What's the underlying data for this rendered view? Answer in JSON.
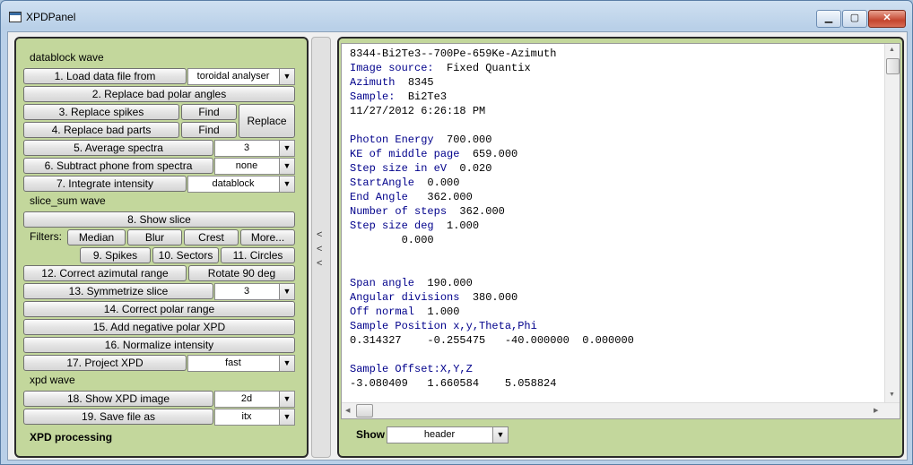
{
  "window": {
    "title": "XPDPanel",
    "min_symbol": "▁",
    "max_symbol": "▢",
    "close_symbol": "✕"
  },
  "left": {
    "section_datablock": "datablock wave",
    "load": {
      "label": "1. Load data file from",
      "value": "toroidal analyser"
    },
    "replace_polar": "2. Replace bad polar angles",
    "replace_spikes": "3. Replace spikes",
    "find1": "Find",
    "replace_parts": "4. Replace bad parts",
    "find2": "Find",
    "replace": "Replace",
    "average": {
      "label": "5. Average spectra",
      "value": "3"
    },
    "subtract": {
      "label": "6. Subtract phone from spectra",
      "value": "none"
    },
    "integrate": {
      "label": "7. Integrate intensity",
      "value": "datablock"
    },
    "section_slice": "slice_sum wave",
    "show_slice": "8. Show slice",
    "filters_label": "Filters:",
    "median": "Median",
    "blur": "Blur",
    "crest": "Crest",
    "more": "More...",
    "spikes": "9. Spikes",
    "sectors": "10. Sectors",
    "circles": "11. Circles",
    "correct_az": "12. Correct azimutal range",
    "rotate": "Rotate 90 deg",
    "symmetrize": {
      "label": "13. Symmetrize slice",
      "value": "3"
    },
    "correct_polar": "14. Correct polar range",
    "add_negative": "15. Add negative polar XPD",
    "normalize": "16. Normalize intensity",
    "project": {
      "label": "17. Project XPD",
      "value": "fast"
    },
    "section_xpd": "xpd wave",
    "show_xpd": {
      "label": "18. Show XPD image",
      "value": "2d"
    },
    "save": {
      "label": "19. Save file as",
      "value": "itx"
    },
    "footer": "XPD processing"
  },
  "splitter": {
    "arrows": [
      "<",
      "<",
      "<"
    ]
  },
  "right": {
    "lines": [
      {
        "k": "",
        "v": "8344-Bi2Te3--700Pe-659Ke-Azimuth"
      },
      {
        "k": "Image source:",
        "v": "  Fixed Quantix"
      },
      {
        "k": "Azimuth",
        "v": "  8345"
      },
      {
        "k": "Sample:",
        "v": "  Bi2Te3"
      },
      {
        "k": "",
        "v": "11/27/2012 6:26:18 PM"
      },
      {
        "k": "",
        "v": ""
      },
      {
        "k": "Photon Energy",
        "v": "  700.000"
      },
      {
        "k": "KE of middle page",
        "v": "  659.000"
      },
      {
        "k": "Step size in eV",
        "v": "  0.020"
      },
      {
        "k": "StartAngle",
        "v": "  0.000"
      },
      {
        "k": "End Angle",
        "v": "   362.000"
      },
      {
        "k": "Number of steps",
        "v": "  362.000"
      },
      {
        "k": "Step size deg",
        "v": "  1.000"
      },
      {
        "k": "",
        "v": "        0.000"
      },
      {
        "k": "",
        "v": ""
      },
      {
        "k": "",
        "v": ""
      },
      {
        "k": "Span angle",
        "v": "  190.000"
      },
      {
        "k": "Angular divisions",
        "v": "  380.000"
      },
      {
        "k": "Off normal",
        "v": "  1.000"
      },
      {
        "k": "Sample Position x,y,Theta,Phi",
        "v": ""
      },
      {
        "k": "",
        "v": "0.314327    -0.255475   -40.000000  0.000000"
      },
      {
        "k": "",
        "v": ""
      },
      {
        "k": "Sample Offset:X,Y,Z",
        "v": ""
      },
      {
        "k": "",
        "v": "-3.080409   1.660584    5.058824"
      }
    ],
    "show_label": "Show",
    "show_value": "header",
    "scroll_up": "▲",
    "scroll_down": "▼",
    "scroll_left": "◀",
    "scroll_right": "▶"
  }
}
